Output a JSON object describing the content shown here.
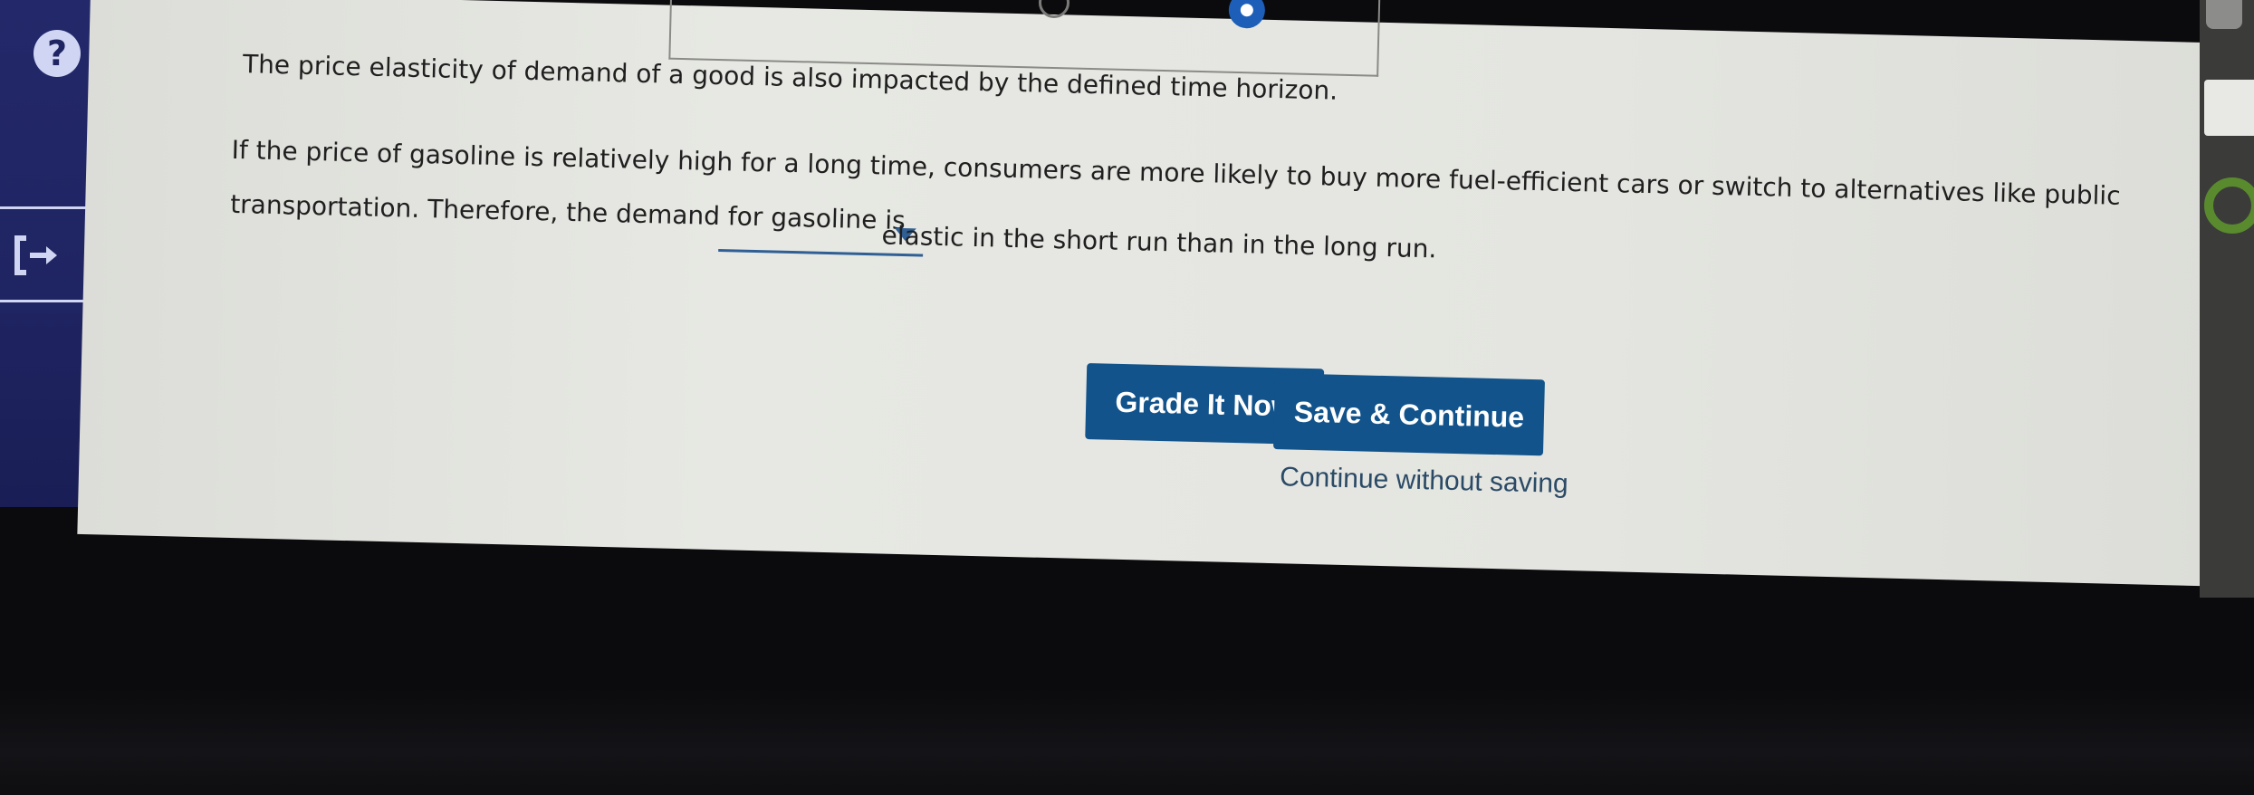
{
  "sidebar": {
    "help_label": "?"
  },
  "question": {
    "intro": "The price elasticity of demand of a good is also impacted by the defined time horizon.",
    "line2": "If the price of gasoline is relatively high for a long time, consumers are more likely to buy more fuel-efficient cars or switch to alternatives like public",
    "line3_before": "transportation. Therefore, the demand for gasoline is",
    "line3_after": "elastic in the short run than in the long run.",
    "dropdown_value": ""
  },
  "actions": {
    "grade_label": "Grade It Now",
    "save_label": "Save & Continue",
    "continue_label": "Continue without saving"
  },
  "colors": {
    "sidebar": "#1f2462",
    "button": "#12538c",
    "radio_selected": "#1d5fb8"
  },
  "icons": [
    "help-icon",
    "exit-icon",
    "dropdown-caret-icon"
  ]
}
